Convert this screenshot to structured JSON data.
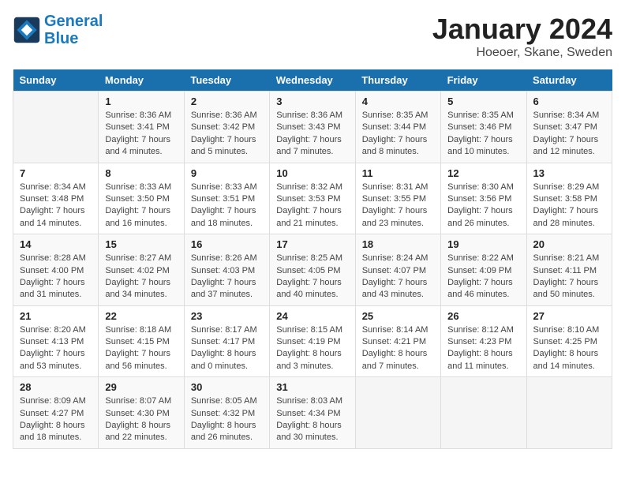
{
  "header": {
    "logo_line1": "General",
    "logo_line2": "Blue",
    "month": "January 2024",
    "location": "Hoeoer, Skane, Sweden"
  },
  "weekdays": [
    "Sunday",
    "Monday",
    "Tuesday",
    "Wednesday",
    "Thursday",
    "Friday",
    "Saturday"
  ],
  "weeks": [
    [
      {
        "num": "",
        "sunrise": "",
        "sunset": "",
        "daylight": ""
      },
      {
        "num": "1",
        "sunrise": "Sunrise: 8:36 AM",
        "sunset": "Sunset: 3:41 PM",
        "daylight": "Daylight: 7 hours and 4 minutes."
      },
      {
        "num": "2",
        "sunrise": "Sunrise: 8:36 AM",
        "sunset": "Sunset: 3:42 PM",
        "daylight": "Daylight: 7 hours and 5 minutes."
      },
      {
        "num": "3",
        "sunrise": "Sunrise: 8:36 AM",
        "sunset": "Sunset: 3:43 PM",
        "daylight": "Daylight: 7 hours and 7 minutes."
      },
      {
        "num": "4",
        "sunrise": "Sunrise: 8:35 AM",
        "sunset": "Sunset: 3:44 PM",
        "daylight": "Daylight: 7 hours and 8 minutes."
      },
      {
        "num": "5",
        "sunrise": "Sunrise: 8:35 AM",
        "sunset": "Sunset: 3:46 PM",
        "daylight": "Daylight: 7 hours and 10 minutes."
      },
      {
        "num": "6",
        "sunrise": "Sunrise: 8:34 AM",
        "sunset": "Sunset: 3:47 PM",
        "daylight": "Daylight: 7 hours and 12 minutes."
      }
    ],
    [
      {
        "num": "7",
        "sunrise": "Sunrise: 8:34 AM",
        "sunset": "Sunset: 3:48 PM",
        "daylight": "Daylight: 7 hours and 14 minutes."
      },
      {
        "num": "8",
        "sunrise": "Sunrise: 8:33 AM",
        "sunset": "Sunset: 3:50 PM",
        "daylight": "Daylight: 7 hours and 16 minutes."
      },
      {
        "num": "9",
        "sunrise": "Sunrise: 8:33 AM",
        "sunset": "Sunset: 3:51 PM",
        "daylight": "Daylight: 7 hours and 18 minutes."
      },
      {
        "num": "10",
        "sunrise": "Sunrise: 8:32 AM",
        "sunset": "Sunset: 3:53 PM",
        "daylight": "Daylight: 7 hours and 21 minutes."
      },
      {
        "num": "11",
        "sunrise": "Sunrise: 8:31 AM",
        "sunset": "Sunset: 3:55 PM",
        "daylight": "Daylight: 7 hours and 23 minutes."
      },
      {
        "num": "12",
        "sunrise": "Sunrise: 8:30 AM",
        "sunset": "Sunset: 3:56 PM",
        "daylight": "Daylight: 7 hours and 26 minutes."
      },
      {
        "num": "13",
        "sunrise": "Sunrise: 8:29 AM",
        "sunset": "Sunset: 3:58 PM",
        "daylight": "Daylight: 7 hours and 28 minutes."
      }
    ],
    [
      {
        "num": "14",
        "sunrise": "Sunrise: 8:28 AM",
        "sunset": "Sunset: 4:00 PM",
        "daylight": "Daylight: 7 hours and 31 minutes."
      },
      {
        "num": "15",
        "sunrise": "Sunrise: 8:27 AM",
        "sunset": "Sunset: 4:02 PM",
        "daylight": "Daylight: 7 hours and 34 minutes."
      },
      {
        "num": "16",
        "sunrise": "Sunrise: 8:26 AM",
        "sunset": "Sunset: 4:03 PM",
        "daylight": "Daylight: 7 hours and 37 minutes."
      },
      {
        "num": "17",
        "sunrise": "Sunrise: 8:25 AM",
        "sunset": "Sunset: 4:05 PM",
        "daylight": "Daylight: 7 hours and 40 minutes."
      },
      {
        "num": "18",
        "sunrise": "Sunrise: 8:24 AM",
        "sunset": "Sunset: 4:07 PM",
        "daylight": "Daylight: 7 hours and 43 minutes."
      },
      {
        "num": "19",
        "sunrise": "Sunrise: 8:22 AM",
        "sunset": "Sunset: 4:09 PM",
        "daylight": "Daylight: 7 hours and 46 minutes."
      },
      {
        "num": "20",
        "sunrise": "Sunrise: 8:21 AM",
        "sunset": "Sunset: 4:11 PM",
        "daylight": "Daylight: 7 hours and 50 minutes."
      }
    ],
    [
      {
        "num": "21",
        "sunrise": "Sunrise: 8:20 AM",
        "sunset": "Sunset: 4:13 PM",
        "daylight": "Daylight: 7 hours and 53 minutes."
      },
      {
        "num": "22",
        "sunrise": "Sunrise: 8:18 AM",
        "sunset": "Sunset: 4:15 PM",
        "daylight": "Daylight: 7 hours and 56 minutes."
      },
      {
        "num": "23",
        "sunrise": "Sunrise: 8:17 AM",
        "sunset": "Sunset: 4:17 PM",
        "daylight": "Daylight: 8 hours and 0 minutes."
      },
      {
        "num": "24",
        "sunrise": "Sunrise: 8:15 AM",
        "sunset": "Sunset: 4:19 PM",
        "daylight": "Daylight: 8 hours and 3 minutes."
      },
      {
        "num": "25",
        "sunrise": "Sunrise: 8:14 AM",
        "sunset": "Sunset: 4:21 PM",
        "daylight": "Daylight: 8 hours and 7 minutes."
      },
      {
        "num": "26",
        "sunrise": "Sunrise: 8:12 AM",
        "sunset": "Sunset: 4:23 PM",
        "daylight": "Daylight: 8 hours and 11 minutes."
      },
      {
        "num": "27",
        "sunrise": "Sunrise: 8:10 AM",
        "sunset": "Sunset: 4:25 PM",
        "daylight": "Daylight: 8 hours and 14 minutes."
      }
    ],
    [
      {
        "num": "28",
        "sunrise": "Sunrise: 8:09 AM",
        "sunset": "Sunset: 4:27 PM",
        "daylight": "Daylight: 8 hours and 18 minutes."
      },
      {
        "num": "29",
        "sunrise": "Sunrise: 8:07 AM",
        "sunset": "Sunset: 4:30 PM",
        "daylight": "Daylight: 8 hours and 22 minutes."
      },
      {
        "num": "30",
        "sunrise": "Sunrise: 8:05 AM",
        "sunset": "Sunset: 4:32 PM",
        "daylight": "Daylight: 8 hours and 26 minutes."
      },
      {
        "num": "31",
        "sunrise": "Sunrise: 8:03 AM",
        "sunset": "Sunset: 4:34 PM",
        "daylight": "Daylight: 8 hours and 30 minutes."
      },
      {
        "num": "",
        "sunrise": "",
        "sunset": "",
        "daylight": ""
      },
      {
        "num": "",
        "sunrise": "",
        "sunset": "",
        "daylight": ""
      },
      {
        "num": "",
        "sunrise": "",
        "sunset": "",
        "daylight": ""
      }
    ]
  ]
}
